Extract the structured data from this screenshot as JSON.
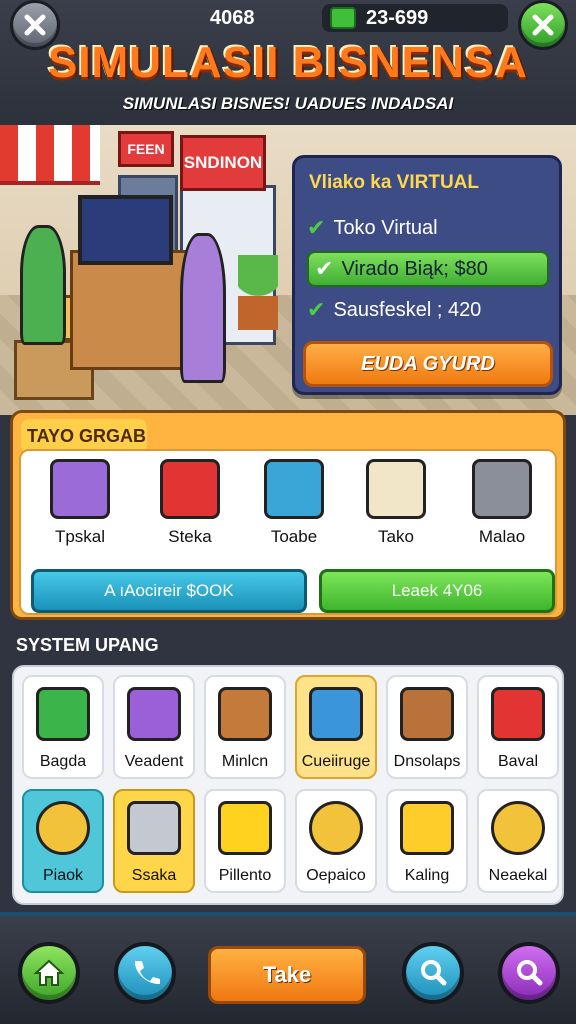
{
  "header": {
    "coins": "4068",
    "cash": "23-699",
    "title": "SIMULASII BISNENSA",
    "subtitle": "SIMUNLASI BISNES! UADUES INDADSAI"
  },
  "scene": {
    "sign_small": "FEEN",
    "sign_big": "SNDINON"
  },
  "info_panel": {
    "title": "Vliako ka VIRTUAL",
    "rows": [
      "Toko Virtual",
      "Virado Biąk; $80",
      "Sausfeskel ; 420"
    ],
    "action": "EUDA GYURD"
  },
  "shop": {
    "header": "TAYO GRGAB",
    "items": [
      "Tpskal",
      "Steka",
      "Toabe",
      "Tako",
      "Malao"
    ],
    "btn_blue": "A ıAocireir $OOK",
    "btn_green": "Leaek 4Y06"
  },
  "system": {
    "title": "SYSTEM UPANG",
    "tiles": [
      "Bagda",
      "Veadent",
      "Minlcn",
      "Cueiiruge",
      "Dnsolaps",
      "Baval",
      "Piaok",
      "Ssaka",
      "Pillento",
      "Oepaico",
      "Kaling",
      "Neaekal"
    ]
  },
  "nav": {
    "take": "Take"
  },
  "colors": {
    "accent_orange": "#f07a10",
    "accent_green": "#3fae33",
    "accent_blue": "#1a92b8",
    "panel_navy": "#3e4c86"
  }
}
